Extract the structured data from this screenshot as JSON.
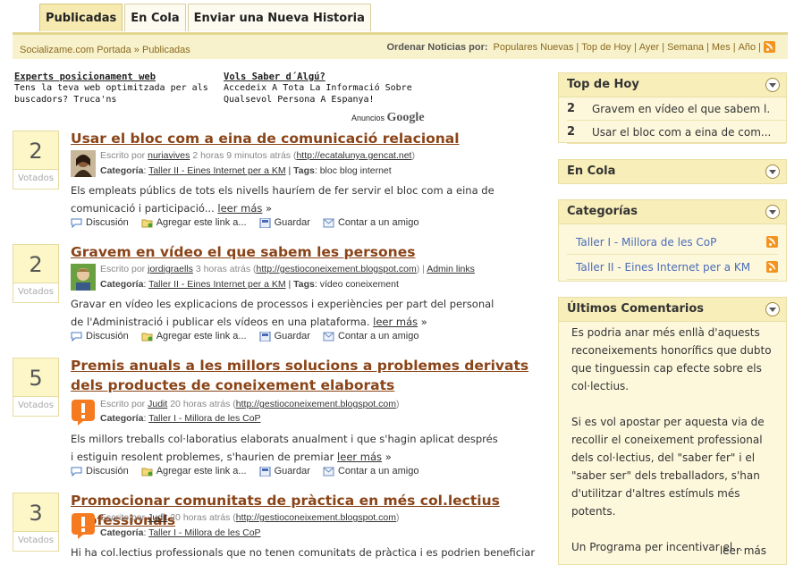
{
  "tabs": [
    {
      "label": "Publicadas",
      "active": true
    },
    {
      "label": "En Cola",
      "active": false
    },
    {
      "label": "Enviar una Nueva Historia",
      "active": false
    }
  ],
  "breadcrumb": {
    "home": "Socializame.com Portada",
    "sep": "»",
    "current": "Publicadas"
  },
  "ordenar": {
    "label": "Ordenar Noticias por:",
    "options": [
      "Populares Nuevas",
      "Top de Hoy",
      "Ayer",
      "Semana",
      "Mes",
      "Año"
    ]
  },
  "ads": [
    {
      "title": "Experts posicionament web",
      "desc": "Tens la teva web optimitzada per als buscadors? Truca'ns"
    },
    {
      "title": "Vols Saber d´Algú?",
      "desc": "Accedeix A Tota La Informació Sobre Qualsevol Persona A Espanya!"
    }
  ],
  "ads_by": {
    "prefix": "Anuncios",
    "brand": "Google"
  },
  "vote_label": "Votados",
  "labels": {
    "written_by": "Escrito por",
    "category": "Categoría",
    "tags": "Tags",
    "read_more": "leer más",
    "read_more_arrow": "»",
    "discussion": "Discusión",
    "add_link": "Agregar este link a...",
    "save": "Guardar",
    "tell_friend": "Contar a un amigo"
  },
  "stories": [
    {
      "votes": "2",
      "title": "Usar el bloc com a eina de comunicació relacional",
      "author": "nuriavives",
      "time": "2 horas 9 minutos atrás",
      "url": "http://ecatalunya.gencat.net",
      "extra": "",
      "category": "Taller II - Eines Internet per a KM",
      "tags": "bloc blog internet",
      "body": "Els empleats públics de tots els nivells hauríem de fer servir el bloc com a eina de comunicació i participació...",
      "avatar": "female"
    },
    {
      "votes": "2",
      "title": "Gravem en vídeo el que sabem les persones",
      "author": "jordigraells",
      "time": "3 horas atrás",
      "url": "http://gestioconeixement.blogspot.com",
      "extra": "Admin links",
      "category": "Taller II - Eines Internet per a KM",
      "tags": "vídeo coneixement",
      "body": "Gravar en vídeo les explicacions de processos i experiències per part del personal de l'Administració i publicar els vídeos en una plataforma.",
      "avatar": "male"
    },
    {
      "votes": "5",
      "title": "Premis anuals a les millors solucions a problemes derivats dels productes de coneixement elaborats",
      "author": "Judit",
      "time": "20 horas atrás",
      "url": "http://gestioconeixement.blogspot.com",
      "extra": "",
      "category": "Taller I - Millora de les CoP",
      "tags": "",
      "body": "Els millors treballs col·laboratius elaborats anualment i que s'hagin aplicat després i estiguin resolent problemes, s'haurien de premiar",
      "avatar": "alert"
    },
    {
      "votes": "3",
      "title": "Promocionar comunitats de pràctica en més col.lectius professionals",
      "author": "Judit",
      "time": "20 horas atrás",
      "url": "http://gestioconeixement.blogspot.com",
      "extra": "",
      "category": "Taller I - Millora de les CoP",
      "tags": "",
      "body": "Hi ha col.lectius professionals que no tenen comunitats de pràctica i es podrien beneficiar",
      "avatar": "alert"
    }
  ],
  "sidebar": {
    "top_today": {
      "title": "Top de Hoy",
      "items": [
        {
          "n": "2",
          "text": "Gravem en vídeo el que sabem l..."
        },
        {
          "n": "2",
          "text": "Usar el bloc com a eina de com..."
        }
      ]
    },
    "queue": {
      "title": "En Cola"
    },
    "categories": {
      "title": "Categorías",
      "items": [
        "Taller I - Millora de les CoP",
        "Taller II - Eines Internet per a KM"
      ]
    },
    "comments": {
      "title": "Últimos Comentarios",
      "text": "Es podria anar més enllà d'aquests reconeixements honorífics que dubto que tinguessin cap efecte sobre els col·lectius.\n\nSi es vol apostar per aquesta via de recollir el coneixement professional dels col·lectius, del \"saber fer\" i el \"saber ser\" dels treballadors, s'han d'utilitzar d'altres estímuls més potents.\n\nUn Programa per incentivar el...",
      "more": "leer más"
    }
  },
  "colors": {
    "title": "#8a4418",
    "accent": "#f8eeb9",
    "link_blue": "#4a6cb8",
    "rss": "#f39420"
  }
}
